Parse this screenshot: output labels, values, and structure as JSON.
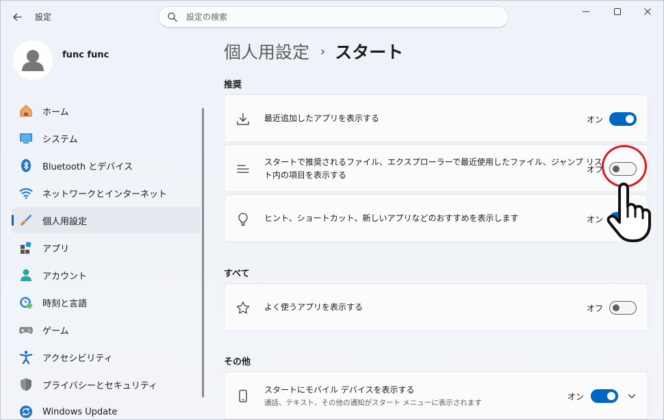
{
  "window": {
    "app_title": "設定"
  },
  "search": {
    "placeholder": "設定の検索"
  },
  "profile": {
    "name": "func func"
  },
  "sidebar": {
    "items": [
      {
        "label": "ホーム",
        "icon": "home-icon"
      },
      {
        "label": "システム",
        "icon": "system-icon"
      },
      {
        "label": "Bluetooth とデバイス",
        "icon": "bluetooth-icon"
      },
      {
        "label": "ネットワークとインターネット",
        "icon": "wifi-icon"
      },
      {
        "label": "個人用設定",
        "icon": "brush-icon",
        "active": true
      },
      {
        "label": "アプリ",
        "icon": "apps-icon"
      },
      {
        "label": "アカウント",
        "icon": "account-icon"
      },
      {
        "label": "時刻と言語",
        "icon": "time-language-icon"
      },
      {
        "label": "ゲーム",
        "icon": "gamepad-icon"
      },
      {
        "label": "アクセシビリティ",
        "icon": "accessibility-icon"
      },
      {
        "label": "プライバシーとセキュリティ",
        "icon": "shield-icon"
      },
      {
        "label": "Windows Update",
        "icon": "update-icon"
      }
    ]
  },
  "header": {
    "parent": "個人用設定",
    "separator": "›",
    "current": "スタート"
  },
  "sections": {
    "recommended": {
      "title": "推奨",
      "items": [
        {
          "label": "最近追加したアプリを表示する",
          "state": "オン",
          "on": true,
          "icon": "download-icon"
        },
        {
          "label_line1": "スタートで推奨されるファイル、エクスプローラーで最近使用したファイル、ジャンプ リス",
          "label_line2": "ト内の項目を表示する",
          "state": "オフ",
          "on": false,
          "icon": "list-icon"
        },
        {
          "label": "ヒント、ショートカット、新しいアプリなどのおすすめを表示します",
          "state": "オン",
          "on": true,
          "icon": "lightbulb-icon"
        }
      ]
    },
    "all": {
      "title": "すべて",
      "items": [
        {
          "label": "よく使うアプリを表示する",
          "state": "オフ",
          "on": false,
          "icon": "star-icon"
        }
      ]
    },
    "other": {
      "title": "その他",
      "items": [
        {
          "label": "スタートにモバイル デバイスを表示する",
          "sublabel": "通話、テキスト、その他の通知がスタート メニューに表示されます",
          "state": "オン",
          "on": true,
          "icon": "phone-icon"
        }
      ]
    }
  },
  "colors": {
    "accent": "#0067c0",
    "highlight": "#e0141e"
  }
}
